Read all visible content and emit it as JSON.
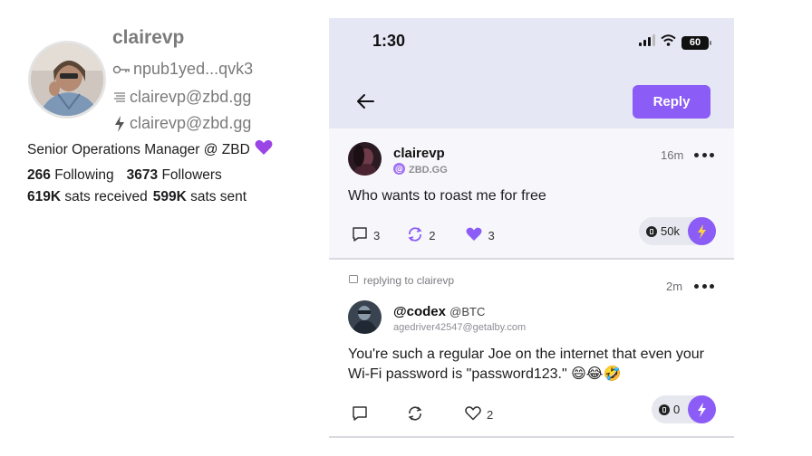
{
  "profile": {
    "username": "clairevp",
    "npub": "npub1yed...qvk3",
    "nip05": "clairevp@zbd.gg",
    "lightning": "clairevp@zbd.gg",
    "bio": "Senior Operations Manager @ ZBD",
    "bio_emoji": "purple-heart",
    "following_count": "266",
    "following_label": "Following",
    "followers_count": "3673",
    "followers_label": "Followers",
    "sats_received": "619K",
    "sats_received_label": "sats received",
    "sats_sent": "599K",
    "sats_sent_label": "sats sent"
  },
  "statusbar": {
    "time": "1:30",
    "battery": "60"
  },
  "header": {
    "reply_label": "Reply"
  },
  "post1": {
    "author": "clairevp",
    "nip05": "ZBD.GG",
    "time": "16m",
    "text": "Who wants to roast me for free",
    "replies": "3",
    "reposts": "2",
    "likes": "3",
    "zap_amount": "50k"
  },
  "post2": {
    "replying_to": "replying to clairevp",
    "author": "@codex",
    "author_tag": "@BTC",
    "nip05": "agedriver42547@getalby.com",
    "time": "2m",
    "text": "You're such a regular Joe on the internet that even your Wi-Fi password is \"password123.\" 😄😂🤣",
    "likes": "2",
    "zap_amount": "0"
  },
  "colors": {
    "accent": "#8b5cf6",
    "header_bg": "#e6e7f5",
    "muted": "#7b7b7b"
  }
}
